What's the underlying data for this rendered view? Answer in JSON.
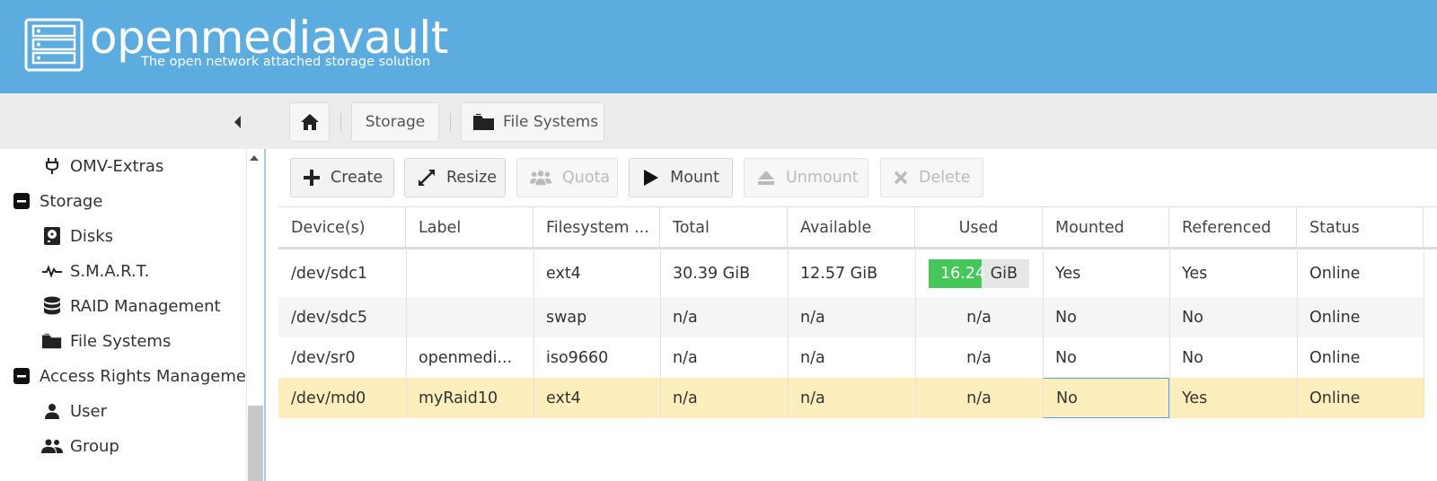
{
  "app": {
    "title": "openmediavault",
    "subtitle": "The open network attached storage solution"
  },
  "breadcrumb": {
    "home_icon": "home-icon",
    "items": [
      "Storage",
      "File Systems"
    ]
  },
  "sidebar": {
    "items": [
      {
        "label": "OMV-Extras",
        "icon": "plug-icon",
        "level": 2
      },
      {
        "label": "Storage",
        "icon": "minus-square-icon",
        "level": 1
      },
      {
        "label": "Disks",
        "icon": "disk-icon",
        "level": 2
      },
      {
        "label": "S.M.A.R.T.",
        "icon": "pulse-icon",
        "level": 2
      },
      {
        "label": "RAID Management",
        "icon": "database-icon",
        "level": 2
      },
      {
        "label": "File Systems",
        "icon": "folder-icon",
        "level": 2
      },
      {
        "label": "Access Rights Managemen",
        "icon": "minus-square-icon",
        "level": 1
      },
      {
        "label": "User",
        "icon": "user-icon",
        "level": 2
      },
      {
        "label": "Group",
        "icon": "group-icon",
        "level": 2
      }
    ]
  },
  "toolbar": {
    "buttons": [
      {
        "label": "Create",
        "icon": "plus-icon",
        "enabled": true
      },
      {
        "label": "Resize",
        "icon": "resize-icon",
        "enabled": true
      },
      {
        "label": "Quota",
        "icon": "users-icon",
        "enabled": false
      },
      {
        "label": "Mount",
        "icon": "play-icon",
        "enabled": true
      },
      {
        "label": "Unmount",
        "icon": "eject-icon",
        "enabled": false
      },
      {
        "label": "Delete",
        "icon": "close-icon",
        "enabled": false
      }
    ]
  },
  "grid": {
    "columns": [
      "Device(s)",
      "Label",
      "Filesystem ...",
      "Total",
      "Available",
      "Used",
      "Mounted",
      "Referenced",
      "Status"
    ],
    "rows": [
      {
        "device": "/dev/sdc1",
        "label": "",
        "fs": "ext4",
        "total": "30.39 GiB",
        "available": "12.57 GiB",
        "used": "16.24",
        "used_unit": "GiB",
        "used_fraction": 0.53,
        "mounted": "Yes",
        "referenced": "Yes",
        "status": "Online"
      },
      {
        "device": "/dev/sdc5",
        "label": "",
        "fs": "swap",
        "total": "n/a",
        "available": "n/a",
        "used": "n/a",
        "mounted": "No",
        "referenced": "No",
        "status": "Online"
      },
      {
        "device": "/dev/sr0",
        "label": "openmedi...",
        "fs": "iso9660",
        "total": "n/a",
        "available": "n/a",
        "used": "n/a",
        "mounted": "No",
        "referenced": "No",
        "status": "Online"
      },
      {
        "device": "/dev/md0",
        "label": "myRaid10",
        "fs": "ext4",
        "total": "n/a",
        "available": "n/a",
        "used": "n/a",
        "mounted": "No",
        "referenced": "Yes",
        "status": "Online",
        "selected": true
      }
    ]
  },
  "colors": {
    "header": "#5dace0",
    "used_fill": "#45c75a",
    "selected_row": "#fdefbd",
    "alt_row": "#f5f5f5"
  }
}
